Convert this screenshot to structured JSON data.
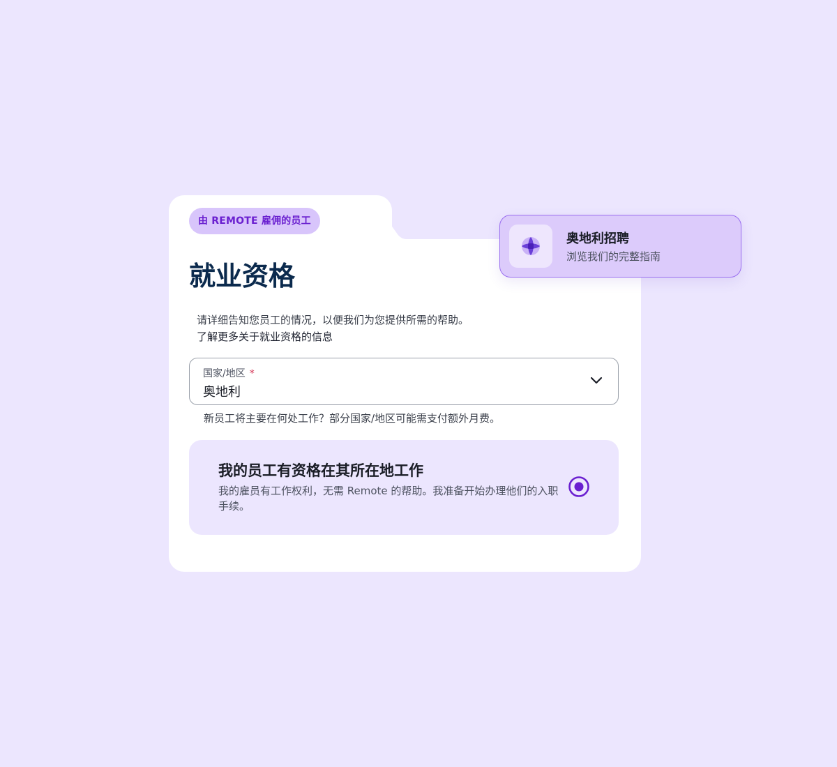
{
  "badge": {
    "label": "由 REMOTE 雇佣的员工"
  },
  "page": {
    "title": "就业资格",
    "description": "请详细告知您员工的情况，以便我们为您提供所需的帮助。",
    "learn_more_link": "了解更多关于就业资格的信息"
  },
  "country_field": {
    "label": "国家/地区",
    "required_marker": "*",
    "value": "奥地利",
    "helper_text": "新员工将主要在何处工作？部分国家/地区可能需支付额外月费。"
  },
  "option": {
    "title": "我的员工有资格在其所在地工作",
    "description": "我的雇员有工作权利，无需 Remote 的帮助。我准备开始办理他们的入职手续。",
    "selected": true
  },
  "promo": {
    "title": "奥地利招聘",
    "subtitle": "浏览我们的完整指南",
    "icon": "globe-icon"
  },
  "colors": {
    "background": "#ece6fe",
    "accent": "#6a1fd0",
    "title": "#0b2a4d",
    "promo_border": "#9a6ef0"
  }
}
